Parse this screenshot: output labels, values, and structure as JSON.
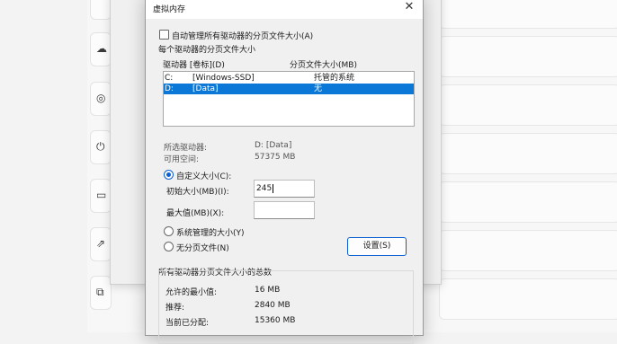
{
  "dialog": {
    "title": "虚拟内存",
    "auto_manage_label": "自动管理所有驱动器的分页文件大小(A)",
    "per_drive_heading": "每个驱动器的分页文件大小",
    "columns": {
      "drive": "驱动器 [卷标](D)",
      "size": "分页文件大小(MB)"
    },
    "drives": [
      {
        "letter": "C:",
        "label": "[Windows-SSD]",
        "size": "托管的系统"
      },
      {
        "letter": "D:",
        "label": "[Data]",
        "size": "无"
      }
    ],
    "selected_drive_label": "所选驱动器:",
    "selected_drive_value": "D:  [Data]",
    "available_space_label": "可用空间:",
    "available_space_value": "57375 MB",
    "custom_size_label": "自定义大小(C):",
    "initial_size_label": "初始大小(MB)(I):",
    "initial_size_value": "245",
    "max_size_label": "最大值(MB)(X):",
    "max_size_value": "",
    "system_managed_label": "系统管理的大小(Y)",
    "no_paging_label": "无分页文件(N)",
    "set_button": "设置(S)",
    "totals_heading": "所有驱动器分页文件大小的总数",
    "min_allowed_label": "允许的最小值:",
    "min_allowed_value": "16 MB",
    "recommended_label": "推荐:",
    "recommended_value": "2840 MB",
    "current_label": "当前已分配:",
    "current_value": "15360 MB"
  },
  "icons": [
    "close-icon",
    "cloud-icon",
    "target-icon",
    "power-icon",
    "storage-icon",
    "share-icon",
    "copy-icon"
  ]
}
